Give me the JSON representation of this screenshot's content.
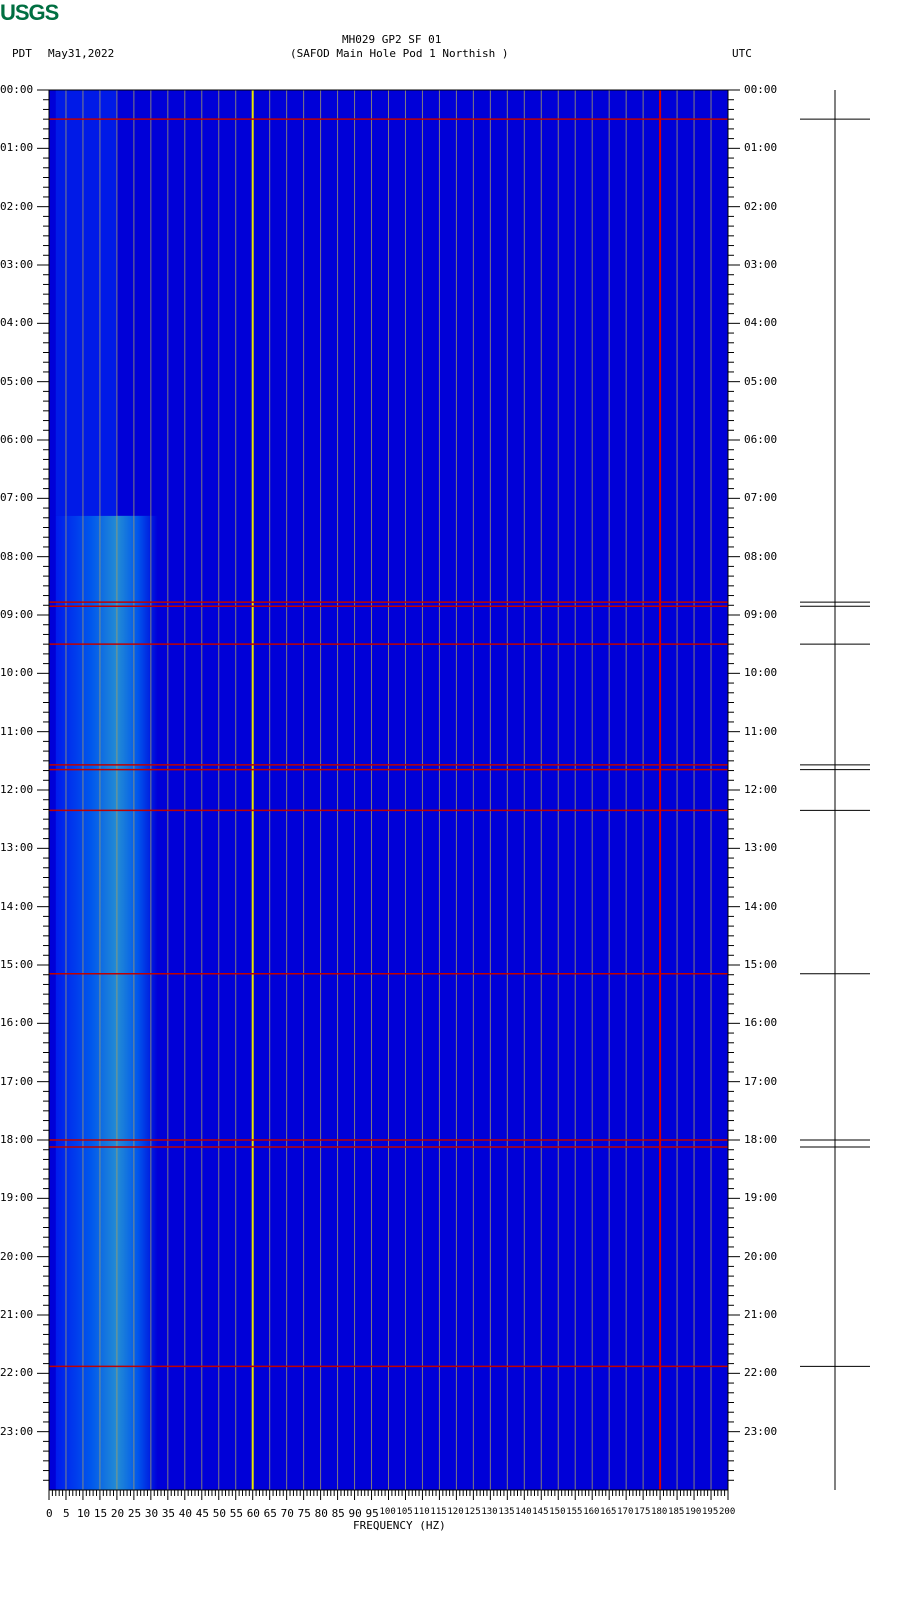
{
  "logo": "USGS",
  "header": {
    "title": "MH029 GP2 SF 01",
    "subtitle": "(SAFOD Main Hole Pod 1 Northish )",
    "left_tz": "PDT",
    "date": "May31,2022",
    "right_tz": "UTC"
  },
  "colors": {
    "background": "#0000d8",
    "grid": "#a09a6a",
    "line60": "#e8e800",
    "line180": "#d80000",
    "event": "#c00000"
  },
  "chart_data": {
    "type": "heatmap",
    "title": "MH029 GP2 SF 01",
    "xlabel": "FREQUENCY (HZ)",
    "xlim": [
      0,
      200
    ],
    "xticks": [
      0,
      5,
      10,
      15,
      20,
      25,
      30,
      35,
      40,
      45,
      50,
      55,
      60,
      65,
      70,
      75,
      80,
      85,
      90,
      95,
      100,
      105,
      110,
      115,
      120,
      125,
      130,
      135,
      140,
      145,
      150,
      155,
      160,
      165,
      170,
      175,
      180,
      185,
      190,
      195,
      200
    ],
    "ylim_hours": [
      0,
      24
    ],
    "left_ticks": [
      "00:00",
      "01:00",
      "02:00",
      "03:00",
      "04:00",
      "05:00",
      "06:00",
      "07:00",
      "08:00",
      "09:00",
      "10:00",
      "11:00",
      "12:00",
      "13:00",
      "14:00",
      "15:00",
      "16:00",
      "17:00",
      "18:00",
      "19:00",
      "20:00",
      "21:00",
      "22:00",
      "23:00"
    ],
    "right_ticks": [
      "07:00",
      "08:00",
      "09:00",
      "10:00",
      "11:00",
      "12:00",
      "13:00",
      "14:00",
      "15:00",
      "16:00",
      "17:00",
      "18:00",
      "19:00",
      "20:00",
      "21:00",
      "22:00",
      "23:00",
      "00:00",
      "01:00",
      "02:00",
      "03:00",
      "04:00",
      "05:00",
      "06:00"
    ],
    "persistent_lines_hz": [
      60,
      180
    ],
    "noise_band_hz": [
      18,
      30
    ],
    "events_hours": [
      0.5,
      8.78,
      8.85,
      9.5,
      11.57,
      11.65,
      12.35,
      15.15,
      18.0,
      18.12,
      21.88
    ]
  }
}
